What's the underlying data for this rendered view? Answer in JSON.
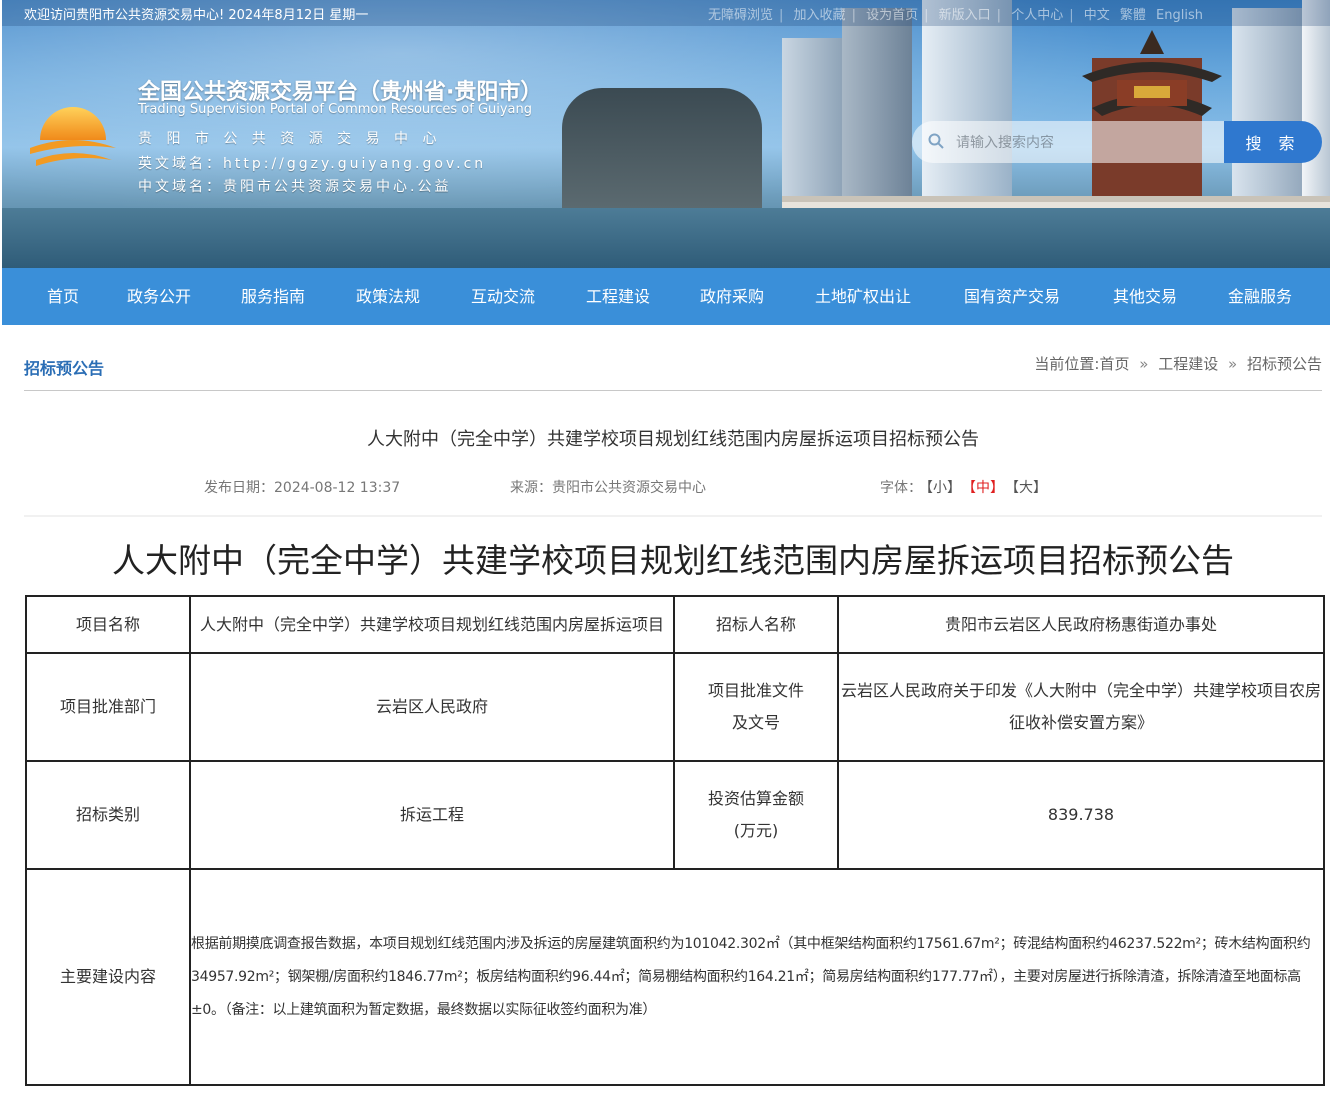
{
  "topbar": {
    "welcome": "欢迎访问贵阳市公共资源交易中心!   2024年8月12日 星期一",
    "links": [
      "无障碍浏览",
      "加入收藏",
      "设为首页",
      "新版入口",
      "个人中心",
      "中文",
      "繁體",
      "English"
    ]
  },
  "header": {
    "title": "全国公共资源交易平台（贵州省·贵阳市）",
    "subtitle": "Trading Supervision Portal of Common Resources of Guiyang",
    "line1": "贵 阳 市 公 共 资 源 交 易 中 心",
    "line2": "英文域名：http://ggzy.guiyang.gov.cn",
    "line3": "中文域名：贵阳市公共资源交易中心.公益"
  },
  "search": {
    "placeholder": "请输入搜索内容",
    "button": "搜 索"
  },
  "nav": {
    "items": [
      "首页",
      "政务公开",
      "服务指南",
      "政策法规",
      "互动交流",
      "工程建设",
      "政府采购",
      "土地矿权出让",
      "国有资产交易",
      "其他交易",
      "金融服务"
    ]
  },
  "breadcrumb": {
    "section": "招标预公告",
    "prefix": "当前位置:首页",
    "sep": "»",
    "level1": "工程建设",
    "level2": "招标预公告"
  },
  "article": {
    "title": "人大附中（完全中学）共建学校项目规划红线范围内房屋拆运项目招标预公告",
    "date": "发布日期：2024-08-12 13:37",
    "source": "来源：贵阳市公共资源交易中心",
    "font_label": "字体：",
    "font_small": "【小】",
    "font_medium": "【中】",
    "font_large": "【大】",
    "heading": "人大附中（完全中学）共建学校项目规划红线范围内房屋拆运项目招标预公告"
  },
  "table": {
    "r1": {
      "k1": "项目名称",
      "v1": "人大附中（完全中学）共建学校项目规划红线范围内房屋拆运项目",
      "k2": "招标人名称",
      "v2": "贵阳市云岩区人民政府杨惠街道办事处"
    },
    "r2": {
      "k1": "项目批准部门",
      "v1": "云岩区人民政府",
      "k2": "项目批准文件及文号",
      "v2": "云岩区人民政府关于印发《人大附中（完全中学）共建学校项目农房征收补偿安置方案》"
    },
    "r3": {
      "k1": "招标类别",
      "v1": "拆运工程",
      "k2": "投资估算金额(万元)",
      "v2": "839.738"
    },
    "r4": {
      "k1": "主要建设内容",
      "v1": "根据前期摸底调查报告数据，本项目规划红线范围内涉及拆运的房屋建筑面积约为101042.302㎡（其中框架结构面积约17561.67m²；砖混结构面积约46237.522m²；砖木结构面积约34957.92m²；钢架棚/房面积约1846.77m²；板房结构面积约96.44㎡；简易棚结构面积约164.21㎡；简易房结构面积约177.77㎡），主要对房屋进行拆除清渣，拆除清渣至地面标高±0。（备注：以上建筑面积为暂定数据，最终数据以实际征收签约面积为准）"
    }
  },
  "colors": {
    "nav": "#3a8fd9",
    "search_button": "#2f78cf",
    "section_title": "#2b6eb5",
    "font_active": "#e02020"
  }
}
